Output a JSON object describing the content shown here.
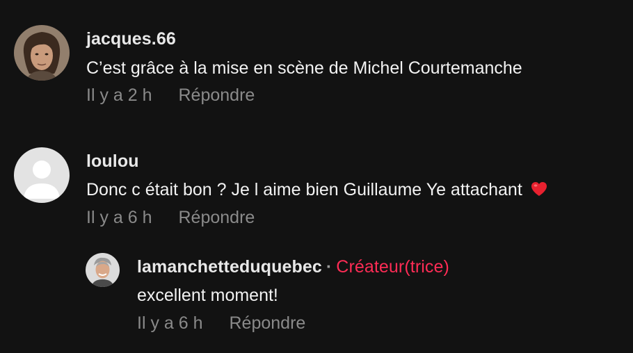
{
  "comments": [
    {
      "username": "jacques.66",
      "text": "C’est grâce à la mise en scène de Michel Courtemanche",
      "time": "Il y a 2 h",
      "reply_label": "Répondre",
      "avatar_icon": "user-photo-avatar"
    },
    {
      "username": "loulou",
      "text": "Donc c était bon ? Je l aime bien Guillaume Ye attachant",
      "emoji": "❤️",
      "time": "Il y a 6 h",
      "reply_label": "Répondre",
      "avatar_icon": "default-user-avatar"
    }
  ],
  "reply": {
    "username": "lamanchetteduquebec",
    "separator": "·",
    "creator_label": "Créateur(trice)",
    "text": "excellent moment!",
    "time": "Il y a 6 h",
    "reply_label": "Répondre",
    "avatar_icon": "creator-photo-avatar"
  },
  "colors": {
    "background": "#121212",
    "creator_accent": "#fe2c55",
    "meta_text": "#8a8a8a"
  }
}
